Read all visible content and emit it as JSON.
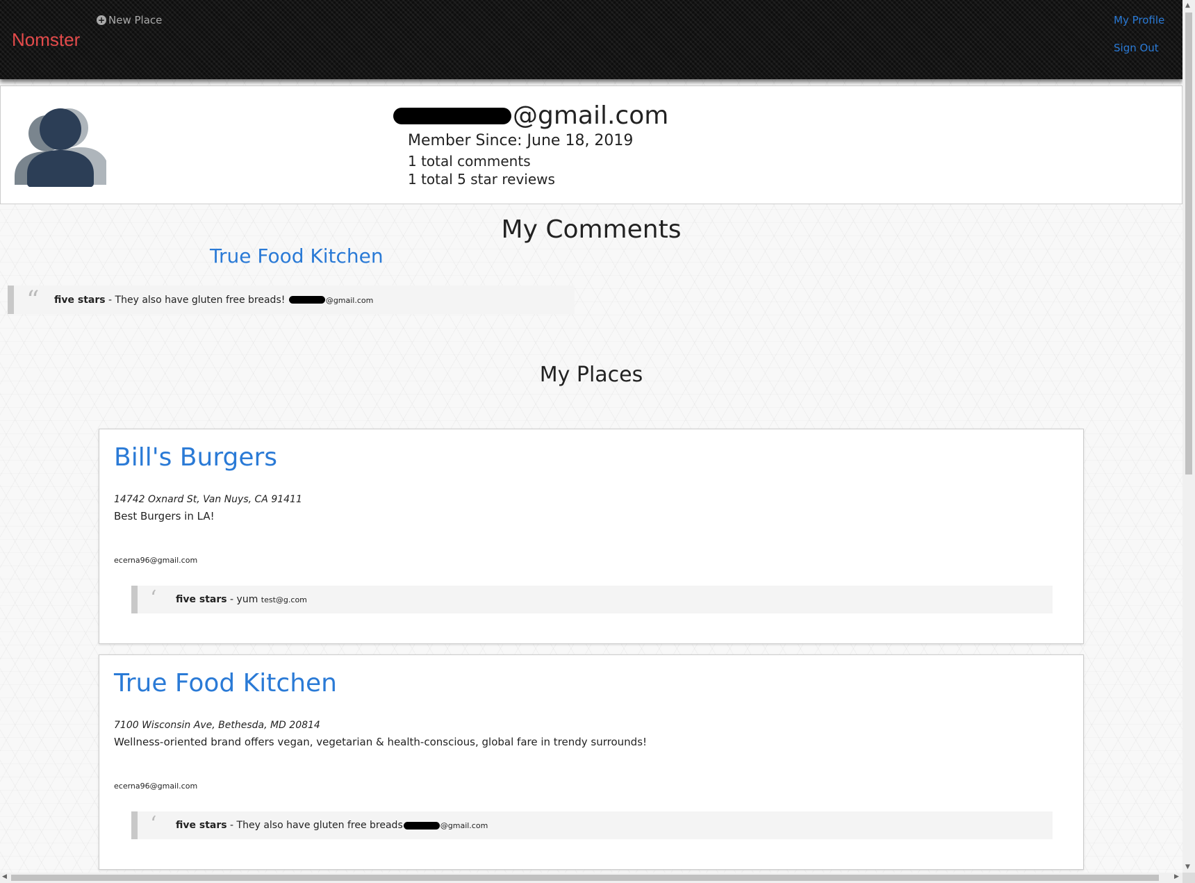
{
  "navbar": {
    "brand": "Nomster",
    "new_place": "New Place",
    "my_profile": "My Profile",
    "sign_out": "Sign Out"
  },
  "profile": {
    "email_suffix": "@gmail.com",
    "member_since": "Member Since: June 18, 2019",
    "total_comments": "1 total comments",
    "total_five_star": "1 total 5 star reviews"
  },
  "my_comments": {
    "heading": "My Comments",
    "place_link": "True Food Kitchen",
    "comment": {
      "rating": "five stars",
      "text": " - They also have gluten free breads! ",
      "author_suffix": "@gmail.com"
    }
  },
  "my_places": {
    "heading": "My Places",
    "places": [
      {
        "name": "Bill's Burgers",
        "address": "14742 Oxnard St, Van Nuys, CA 91411",
        "description": "Best Burgers in LA!",
        "owner": "ecerna96@gmail.com",
        "comment": {
          "rating": "five stars",
          "text": " - yum ",
          "author": "test@g.com"
        }
      },
      {
        "name": "True Food Kitchen",
        "address": "7100 Wisconsin Ave, Bethesda, MD 20814",
        "description": "Wellness-oriented brand offers vegan, vegetarian & health-conscious, global fare in trendy surrounds!",
        "owner": "ecerna96@gmail.com",
        "comment": {
          "rating": "five stars",
          "text": " - They also have gluten free breads",
          "author_suffix": "@gmail.com"
        }
      }
    ]
  },
  "icons": {
    "new_place": "plus-circle-icon",
    "avatar": "users-icon",
    "quote": "quote-icon"
  },
  "colors": {
    "brand": "#e54b4b",
    "link": "#2a7ad6",
    "navbar_bg": "#141414"
  }
}
